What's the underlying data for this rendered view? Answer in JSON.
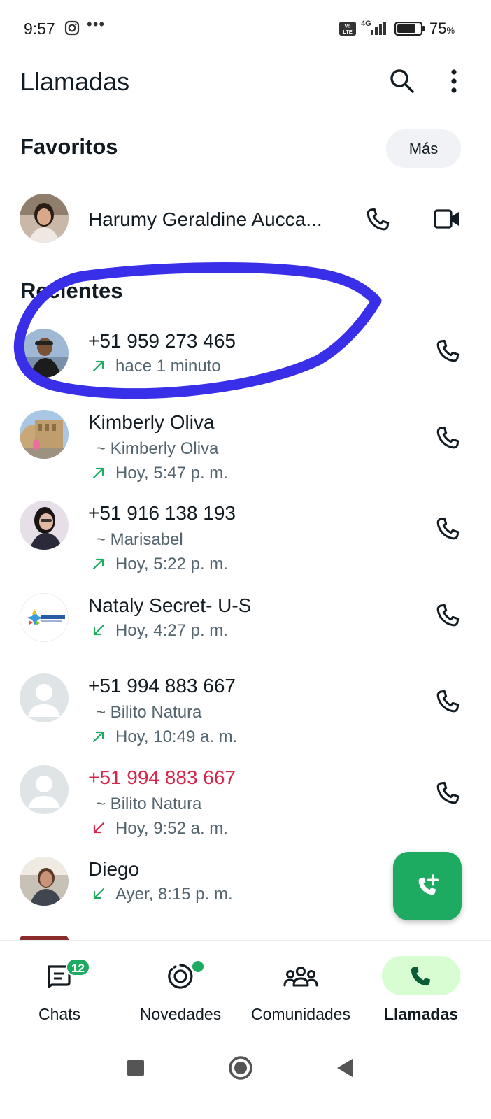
{
  "status_bar": {
    "time": "9:57",
    "network": "4G",
    "battery": "75",
    "battery_unit": "%"
  },
  "header": {
    "title": "Llamadas"
  },
  "favorites": {
    "heading": "Favoritos",
    "more_label": "Más",
    "items": [
      {
        "name": "Harumy Geraldine Aucca..."
      }
    ]
  },
  "recents": {
    "heading": "Recientes",
    "items": [
      {
        "name": "+51 959 273 465",
        "alias": "",
        "time": "hace 1 minuto",
        "direction": "outgoing",
        "missed": false
      },
      {
        "name": "Kimberly Oliva",
        "alias": "~ Kimberly Oliva",
        "time": "Hoy, 5:47 p. m.",
        "direction": "outgoing",
        "missed": false
      },
      {
        "name": "+51 916 138 193",
        "alias": "~ Marisabel",
        "time": "Hoy, 5:22 p. m.",
        "direction": "outgoing",
        "missed": false
      },
      {
        "name": "Nataly Secret- U-S",
        "alias": "",
        "time": "Hoy, 4:27 p. m.",
        "direction": "incoming",
        "missed": false
      },
      {
        "name": "+51 994 883 667",
        "alias": "~ Bilito Natura",
        "time": "Hoy, 10:49 a. m.",
        "direction": "outgoing",
        "missed": false
      },
      {
        "name": "+51 994 883 667",
        "alias": "~ Bilito Natura",
        "time": "Hoy, 9:52 a. m.",
        "direction": "incoming",
        "missed": true
      },
      {
        "name": "Diego",
        "alias": "",
        "time": "Ayer, 8:15 p. m.",
        "direction": "incoming",
        "missed": false
      }
    ]
  },
  "bottom_nav": {
    "items": [
      {
        "label": "Chats",
        "badge": "12"
      },
      {
        "label": "Novedades"
      },
      {
        "label": "Comunidades"
      },
      {
        "label": "Llamadas",
        "active": true
      }
    ]
  },
  "colors": {
    "accent": "#1daa61",
    "missed": "#d5264c",
    "annotation": "#3a2fe8",
    "active_pill": "#d8fdd2"
  },
  "icons": [
    "instagram-icon",
    "search-icon",
    "more-vert-icon",
    "phone-icon",
    "video-icon",
    "arrow-outgoing-icon",
    "arrow-incoming-icon",
    "add-call-icon",
    "chats-icon",
    "updates-icon",
    "communities-icon",
    "calls-icon"
  ]
}
